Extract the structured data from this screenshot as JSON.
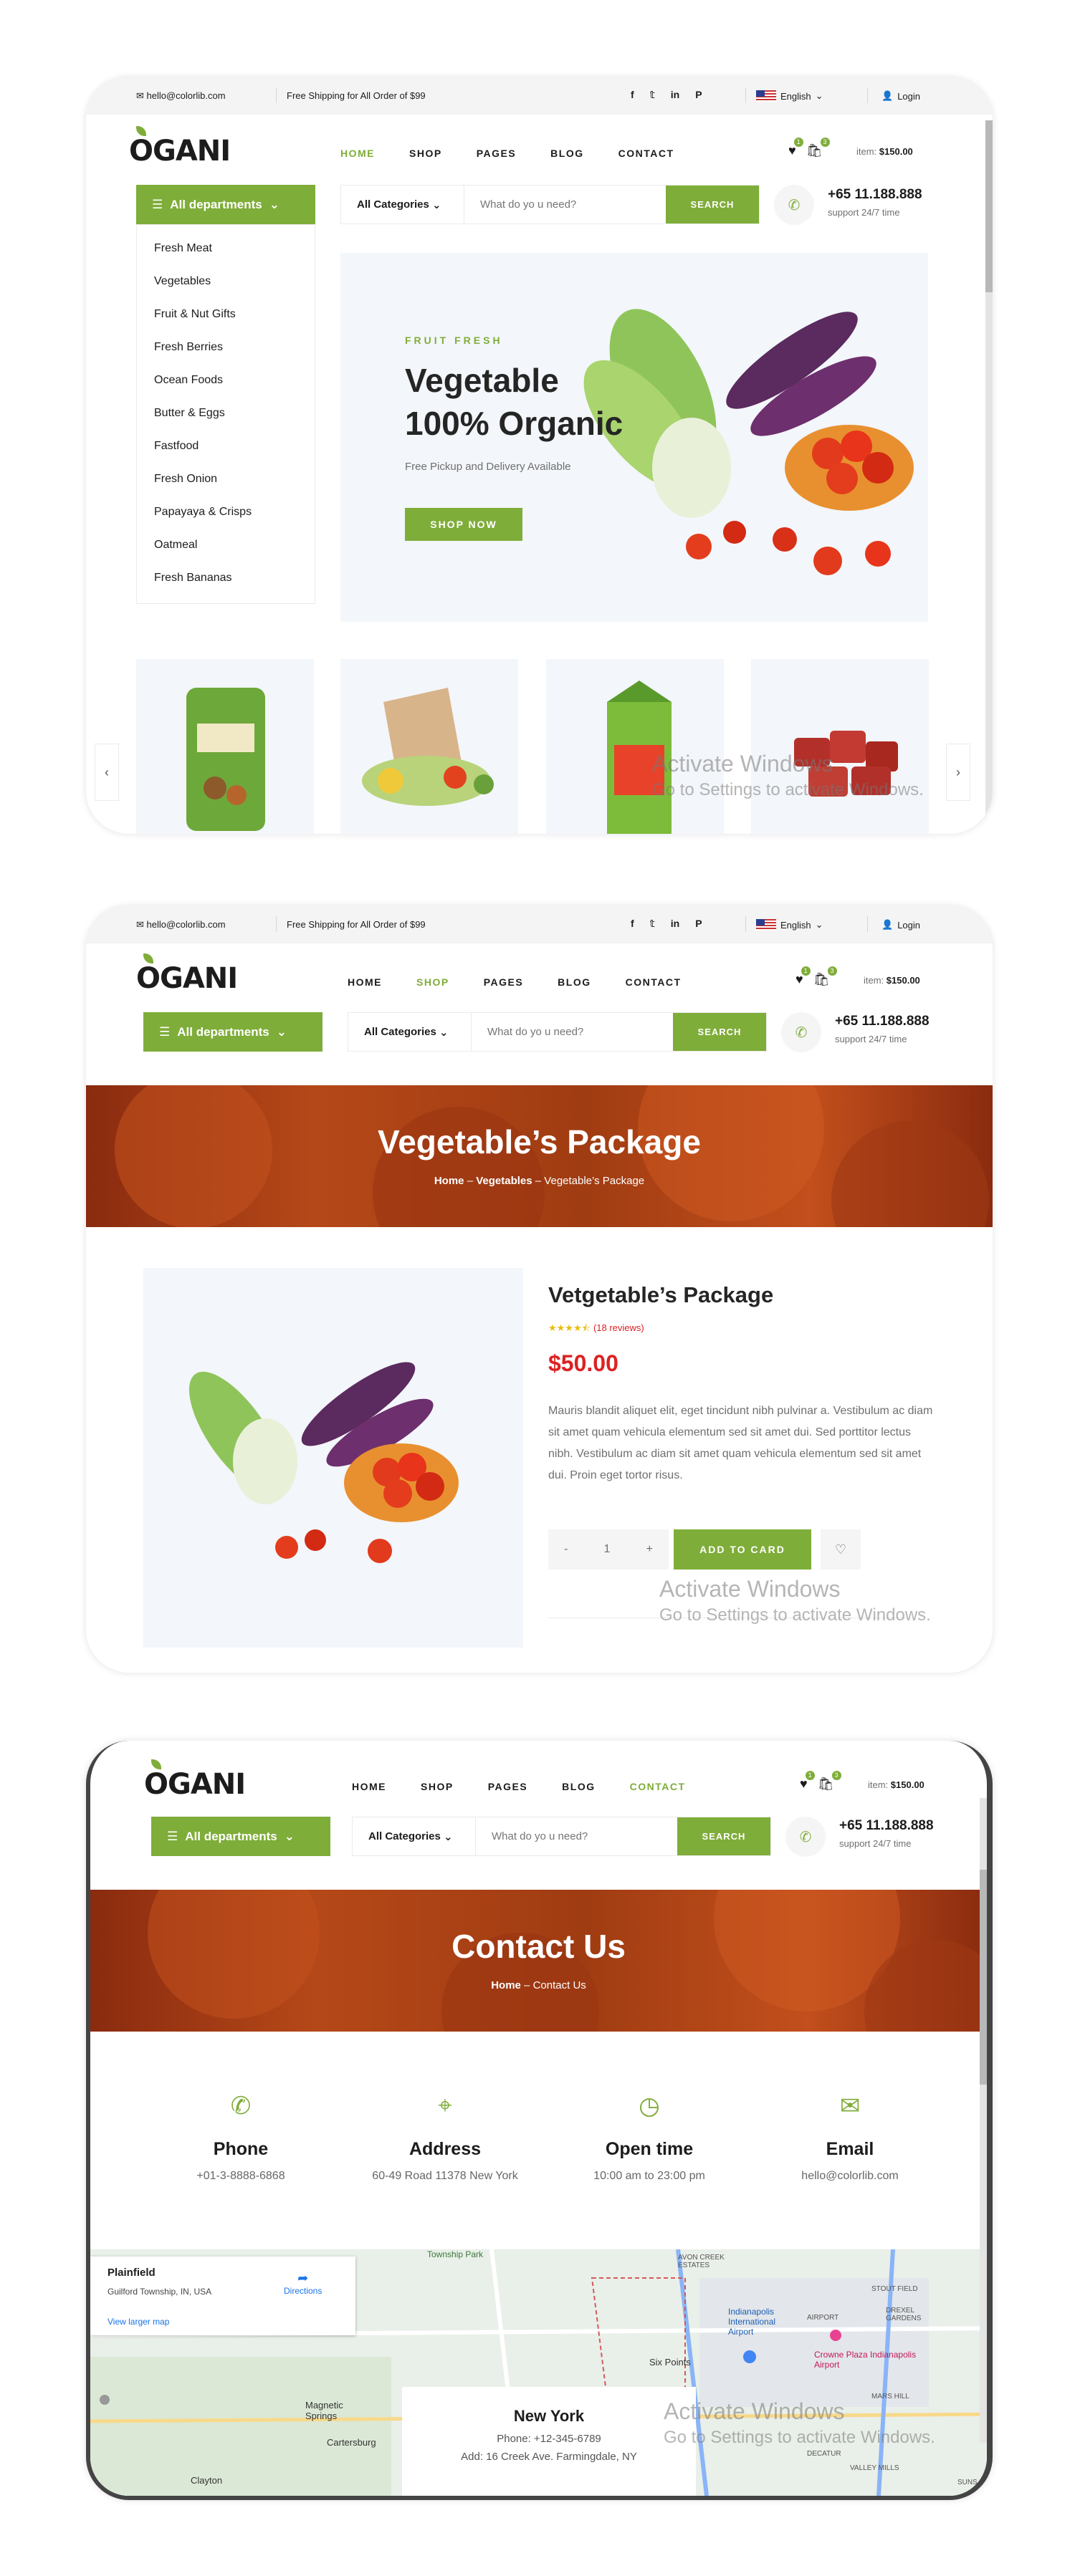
{
  "topbar": {
    "email": "hello@colorlib.com",
    "shipping": "Free Shipping for All Order of $99",
    "language": "English",
    "login": "Login"
  },
  "brand": {
    "logo": "OGANI"
  },
  "nav": {
    "home": "HOME",
    "shop": "SHOP",
    "pages": "PAGES",
    "blog": "BLOG",
    "contact": "CONTACT"
  },
  "cart": {
    "wishlist_count": "1",
    "cart_count": "3",
    "item_label": "item:",
    "item_total": "$150.00"
  },
  "search": {
    "departments_label": "All departments",
    "categories_label": "All Categories",
    "placeholder": "What do yo u need?",
    "button": "SEARCH"
  },
  "contact_line": {
    "phone": "+65 11.188.888",
    "support": "support 24/7 time"
  },
  "departments": [
    "Fresh Meat",
    "Vegetables",
    "Fruit & Nut Gifts",
    "Fresh Berries",
    "Ocean Foods",
    "Butter & Eggs",
    "Fastfood",
    "Fresh Onion",
    "Papayaya & Crisps",
    "Oatmeal",
    "Fresh Bananas"
  ],
  "hero": {
    "tag": "FRUIT FRESH",
    "title_line1": "Vegetable",
    "title_line2": "100% Organic",
    "subtitle": "Free Pickup and Delivery Available",
    "cta": "SHOP NOW"
  },
  "category_slider": {
    "prev_icon": "chevron-left-icon",
    "next_icon": "chevron-right-icon"
  },
  "watermark": {
    "line1": "Activate Windows",
    "line2": "Go to Settings to activate Windows."
  },
  "product_page": {
    "banner_title": "Vegetable’s Package",
    "breadcrumb": [
      "Home",
      "Vegetables",
      "Vegetable’s Package"
    ],
    "title": "Vetgetable’s Package",
    "rating": 4.5,
    "reviews": "(18 reviews)",
    "price": "$50.00",
    "description": "Mauris blandit aliquet elit, eget tincidunt nibh pulvinar a. Vestibulum ac diam sit amet quam vehicula elementum sed sit amet dui. Sed porttitor lectus nibh. Vestibulum ac diam sit amet quam vehicula elementum sed sit amet dui. Proin eget tortor risus.",
    "qty": "1",
    "add_to_cart": "ADD TO CARD"
  },
  "contact_page": {
    "banner_title": "Contact Us",
    "breadcrumb": [
      "Home",
      "Contact Us"
    ],
    "items": [
      {
        "label": "Phone",
        "value": "+01-3-8888-6868",
        "icon": "phone-icon"
      },
      {
        "label": "Address",
        "value": "60-49 Road 11378 New York",
        "icon": "map-pin-icon"
      },
      {
        "label": "Open time",
        "value": "10:00 am to 23:00 pm",
        "icon": "clock-icon"
      },
      {
        "label": "Email",
        "value": "hello@colorlib.com",
        "icon": "envelope-icon"
      }
    ],
    "map": {
      "place": "Plainfield",
      "place_sub": "Guilford Township, IN, USA",
      "directions": "Directions",
      "larger_map": "View larger map",
      "labels": [
        "Township Park",
        "Indianapolis International Airport",
        "Crowne Plaza Indianapolis Airport",
        "Six Points",
        "Magnetic Springs",
        "Cartersburg",
        "Clayton",
        "AVON CREEK ESTATES",
        "STOUT FIELD",
        "DREXEL GARDENS",
        "MARS HILL",
        "DECATUR",
        "VALLEY MILLS",
        "AIRPORT",
        "SUNS"
      ],
      "info_title": "New York",
      "info_phone": "Phone: +12-345-6789",
      "info_address": "Add: 16 Creek Ave. Farmingdale, NY"
    }
  }
}
